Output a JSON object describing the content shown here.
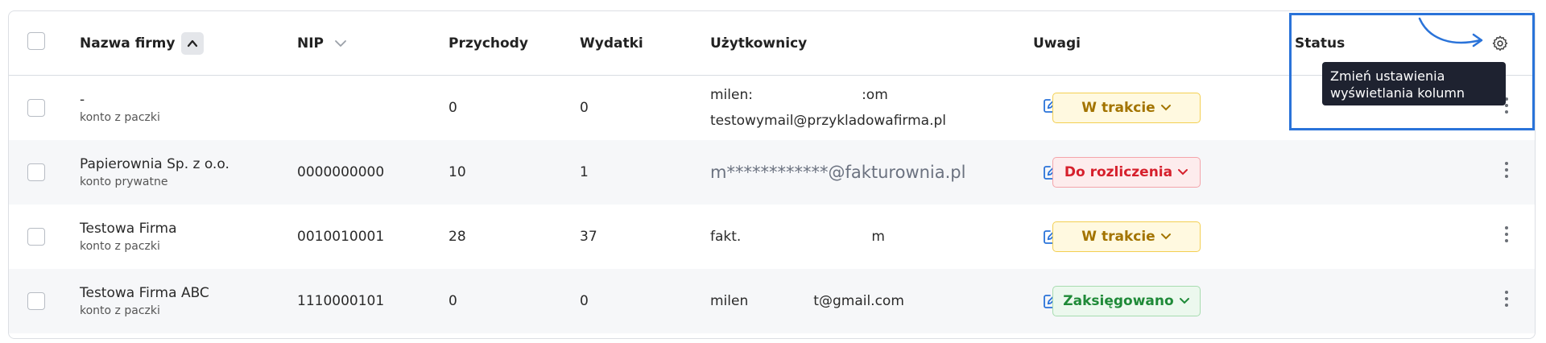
{
  "header": {
    "col_name": "Nazwa firmy",
    "col_nip": "NIP",
    "col_income": "Przychody",
    "col_expenses": "Wydatki",
    "col_users": "Użytkownicy",
    "col_notes": "Uwagi",
    "col_status": "Status"
  },
  "tooltip": {
    "text": "Zmień ustawienia wyświetlania kolumn"
  },
  "rows": [
    {
      "name": "-",
      "account": "konto z paczki",
      "nip": "",
      "income": "0",
      "expenses": "0",
      "users": [
        "milen:                         :om",
        "testowymail@przykladowafirma.pl"
      ],
      "status": "W trakcie"
    },
    {
      "name": "Papierownia Sp. z o.o.",
      "account": "konto prywatne",
      "nip": "0000000000",
      "income": "10",
      "expenses": "1",
      "users": [
        "m************@fakturownia.pl"
      ],
      "status": "Do rozliczenia"
    },
    {
      "name": "Testowa Firma",
      "account": "konto z paczki",
      "nip": "0010010001",
      "income": "28",
      "expenses": "37",
      "users": [
        "fakt.                              m"
      ],
      "status": "W trakcie"
    },
    {
      "name": "Testowa Firma ABC",
      "account": "konto z paczki",
      "nip": "1110000101",
      "income": "0",
      "expenses": "0",
      "users": [
        "milen               t@gmail.com"
      ],
      "status": "Zaksięgowano"
    }
  ],
  "colors": {
    "accent_blue": "#2a73d9",
    "status_do_rozliczenia": "#d61f2c",
    "status_w_trakcie": "#a37400",
    "status_zaksiegowano": "#1f8a38"
  },
  "icons": [
    "chevron-up-icon",
    "chevron-down-icon",
    "edit-icon",
    "gear-icon",
    "kebab-menu-icon",
    "curved-arrow-icon"
  ]
}
